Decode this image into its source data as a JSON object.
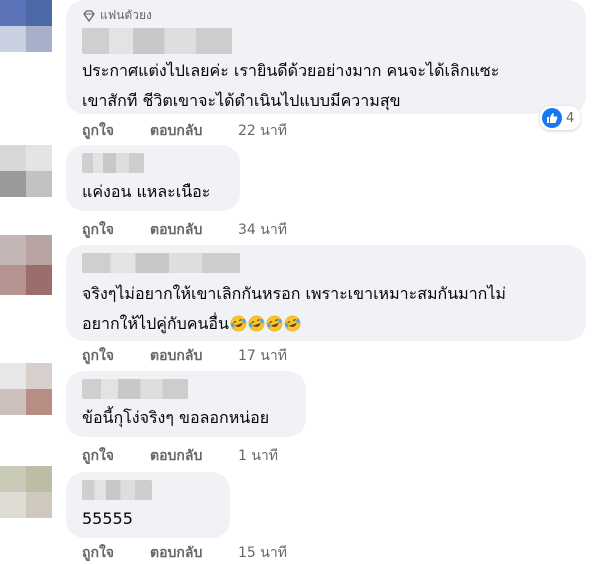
{
  "comments": [
    {
      "badge": "แฟนตัวยง",
      "lines": [
        "ประกาศแต่งไปเลยค่ะ เรายินดีด้วยอย่างมาก คนจะได้เลิกแซะ",
        "เขาสักที ชีวิตเขาจะได้ดำเนินไปแบบมีความสุข"
      ],
      "like_label": "ถูกใจ",
      "reply_label": "ตอบกลับ",
      "time": "22 นาที",
      "reaction_count": "4"
    },
    {
      "lines": [
        "แค่งอน แหละเนือะ"
      ],
      "like_label": "ถูกใจ",
      "reply_label": "ตอบกลับ",
      "time": "34 นาที"
    },
    {
      "lines": [
        "จริงๆไม่อยากให้เขาเลิกกันหรอก เพราะเขาเหมาะสมกันมากไม่",
        "อยากให้ไปคู่กับคนอื่น"
      ],
      "like_label": "ถูกใจ",
      "reply_label": "ตอบกลับ",
      "time": "17 นาที",
      "emoji_count": 4
    },
    {
      "lines": [
        "ข้อนี้กุโง่จริงๆ ขอลอกหน่อย"
      ],
      "like_label": "ถูกใจ",
      "reply_label": "ตอบกลับ",
      "time": "1 นาที"
    },
    {
      "lines": [
        "55555"
      ],
      "like_label": "ถูกใจ",
      "reply_label": "ตอบกลับ",
      "time": "15 นาที"
    }
  ],
  "colors": {
    "bubble": "#f0f2f5",
    "meta_text": "#65676b",
    "like_blue": "#1877f2"
  }
}
